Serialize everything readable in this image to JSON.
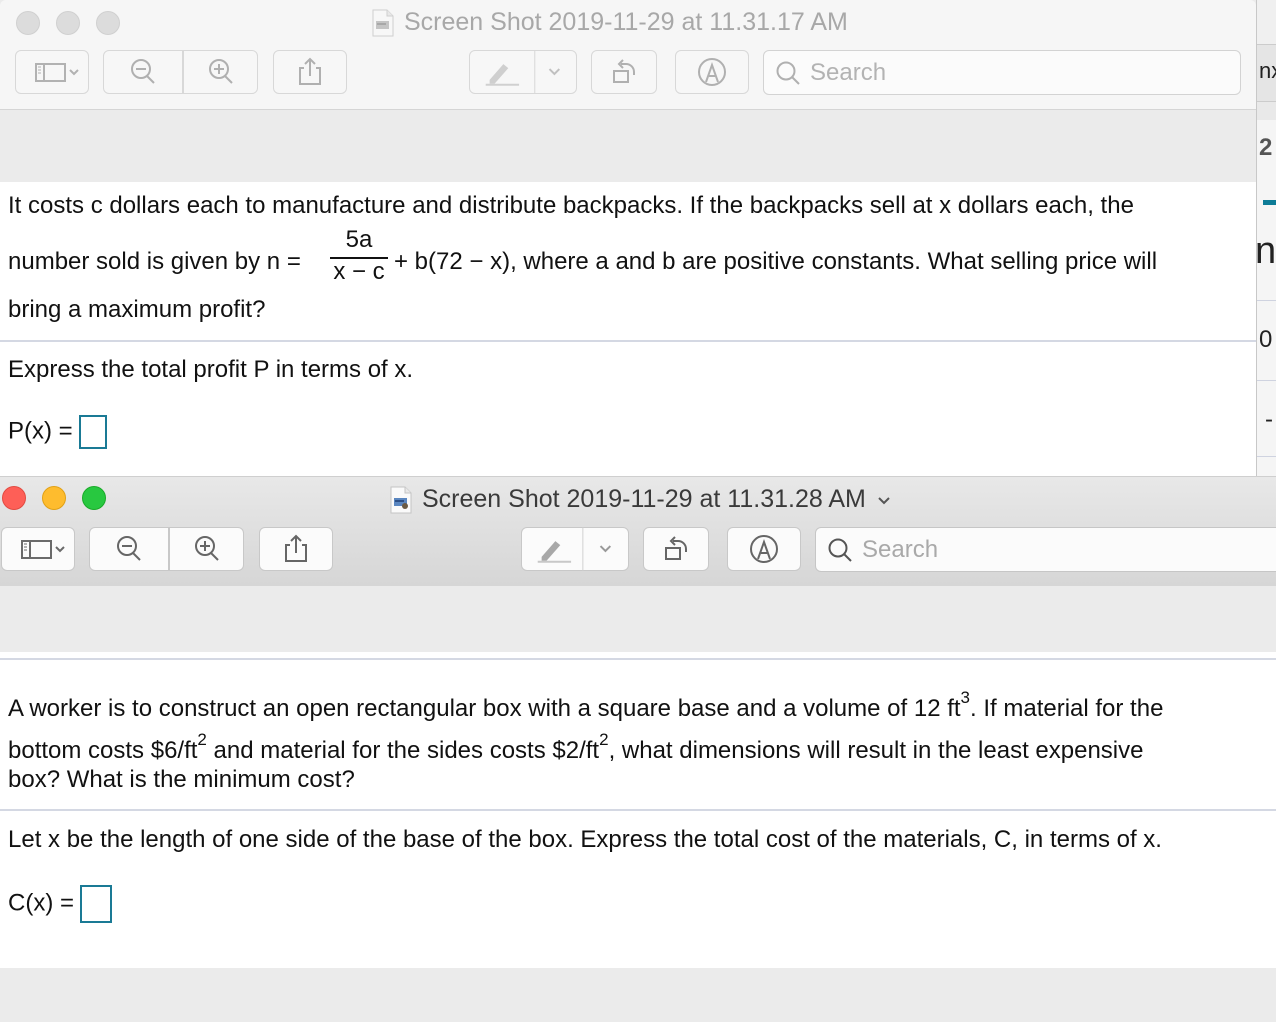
{
  "background_window": {
    "fragments": [
      "nx",
      "2",
      "n",
      "0",
      "-"
    ]
  },
  "window1": {
    "title": "Screen Shot 2019-11-29 at 11.31.17 AM",
    "state": "inactive",
    "toolbar": {
      "sidebar_button": "sidebar-toggle",
      "zoom_out": "zoom-out",
      "zoom_in": "zoom-in",
      "share": "share",
      "highlight": "highlight",
      "rotate": "rotate-left",
      "markup": "markup",
      "search_placeholder": "Search"
    },
    "question": {
      "line1": "It costs c dollars each to manufacture and distribute backpacks. If the backpacks sell at x dollars each, the",
      "line2_prefix": "number sold is given by n =",
      "fraction_numerator": "5a",
      "fraction_denominator": "x − c",
      "line2_suffix": "+ b(72 − x), where a and b are positive constants. What selling price will",
      "line3": "bring a maximum profit?"
    },
    "prompt": "Express the total profit P in terms of x.",
    "answer_label": "P(x) =",
    "answer_value": ""
  },
  "window2": {
    "title": "Screen Shot 2019-11-29 at 11.31.28 AM",
    "state": "active",
    "toolbar": {
      "search_placeholder": "Search"
    },
    "question": {
      "line1_a": "A worker is to construct an open rectangular box with a square base and a volume of 12 ft",
      "line1_sup": "3",
      "line1_b": ". If material for the",
      "line2_a": "bottom costs $6/ft",
      "line2_sup1": "2",
      "line2_b": " and material for the sides costs $2/ft",
      "line2_sup2": "2",
      "line2_c": ", what dimensions will result in the least expensive",
      "line3": "box? What is the minimum cost?"
    },
    "prompt": "Let x be the length of one side of the base of the box. Express the total cost of the materials, C, in terms of x.",
    "answer_label": "C(x) =",
    "answer_value": ""
  },
  "colors": {
    "answer_box_border": "#1a7a95",
    "traffic_red": "#fe5f57",
    "traffic_yellow": "#febc2e",
    "traffic_green": "#28c840"
  }
}
